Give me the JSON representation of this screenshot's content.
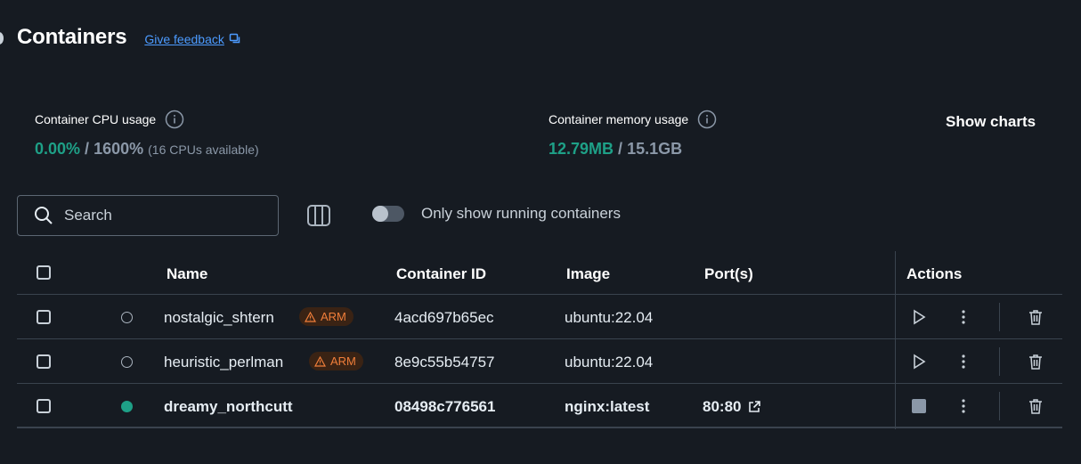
{
  "header": {
    "title": "Containers",
    "feedback_label": "Give feedback"
  },
  "stats": {
    "cpu": {
      "label": "Container CPU usage",
      "used": "0.00%",
      "separator": " / ",
      "total": "1600%",
      "note": "(16 CPUs available)"
    },
    "memory": {
      "label": "Container memory usage",
      "used": "12.79MB",
      "separator": " / ",
      "total": "15.1GB"
    },
    "show_charts_label": "Show charts"
  },
  "toolbar": {
    "search_placeholder": "Search",
    "toggle_label": "Only show running containers",
    "toggle_on": false
  },
  "table": {
    "columns": {
      "name": "Name",
      "container_id": "Container ID",
      "image": "Image",
      "ports": "Port(s)",
      "actions": "Actions"
    },
    "rows": [
      {
        "name": "nostalgic_shtern",
        "arch_badge": "ARM",
        "container_id": "4acd697b65ec",
        "image": "ubuntu:22.04",
        "ports": "",
        "status": "stopped"
      },
      {
        "name": "heuristic_perlman",
        "arch_badge": "ARM",
        "container_id": "8e9c55b54757",
        "image": "ubuntu:22.04",
        "ports": "",
        "status": "stopped"
      },
      {
        "name": "dreamy_northcutt",
        "arch_badge": "",
        "container_id": "08498c776561",
        "image": "nginx:latest",
        "ports": "80:80",
        "status": "running"
      }
    ]
  },
  "colors": {
    "background": "#161b22",
    "accent_green": "#1ea087",
    "link_blue": "#4c9bff",
    "warning_orange": "#f07e3a"
  }
}
